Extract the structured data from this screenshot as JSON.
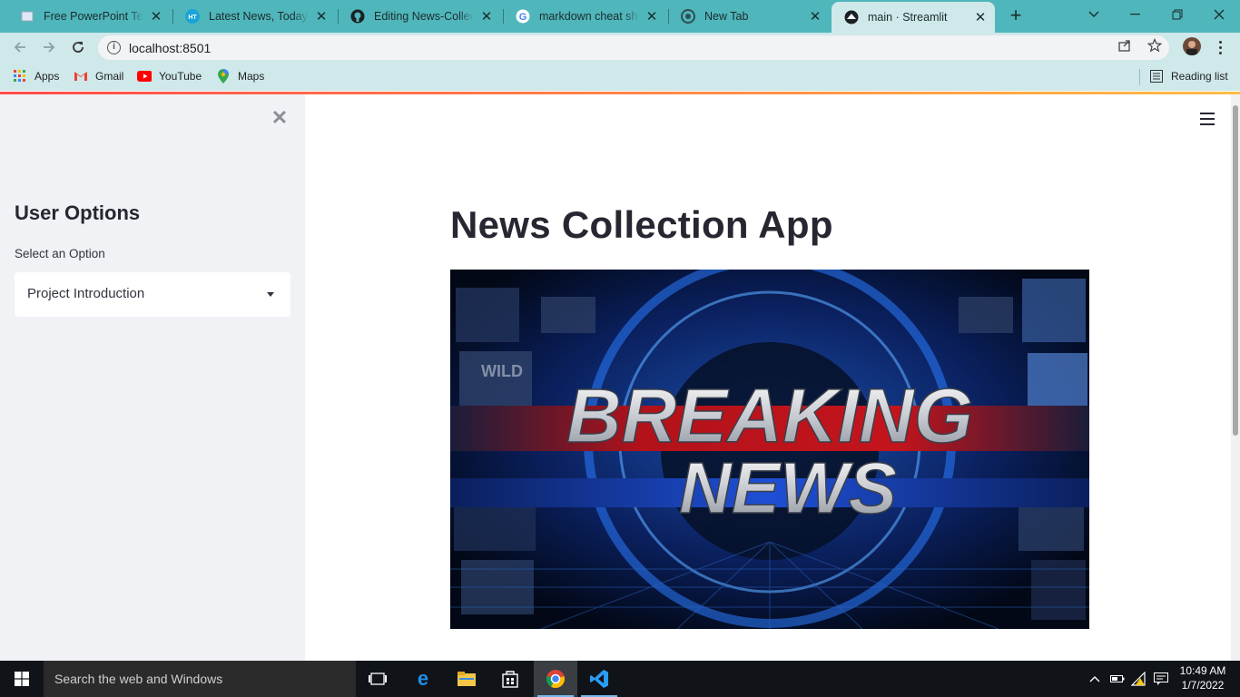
{
  "tabs": [
    {
      "title": "Free PowerPoint Temp",
      "icon": "slides-icon"
    },
    {
      "title": "Latest News, Today's E",
      "icon": "ht-icon"
    },
    {
      "title": "Editing News-Collectio",
      "icon": "github-icon"
    },
    {
      "title": "markdown cheat shee",
      "icon": "google-icon"
    },
    {
      "title": "New Tab",
      "icon": "chrome-icon"
    },
    {
      "title": "main · Streamlit",
      "icon": "streamlit-icon",
      "active": true
    }
  ],
  "address_bar": {
    "url": "localhost:8501"
  },
  "bookmarks": [
    {
      "label": "Apps",
      "icon": "apps-grid-icon"
    },
    {
      "label": "Gmail",
      "icon": "gmail-icon"
    },
    {
      "label": "YouTube",
      "icon": "youtube-icon"
    },
    {
      "label": "Maps",
      "icon": "maps-icon"
    }
  ],
  "reading_list": {
    "label": "Reading list"
  },
  "sidebar": {
    "title": "User Options",
    "select_label": "Select an Option",
    "select_value": "Project Introduction"
  },
  "main": {
    "title": "News Collection App",
    "hero_image": {
      "text_line1": "BREAKING",
      "text_line2": "NEWS",
      "overlay_text": "WILD"
    }
  },
  "taskbar": {
    "search_placeholder": "Search the web and Windows",
    "time": "10:49 AM",
    "date": "1/7/2022"
  },
  "colors": {
    "tabstrip": "#4fb6bb",
    "toolbar": "#cfe8ea",
    "sidebar": "#f0f2f6",
    "text": "#262730",
    "accent_start": "#ff4b4b",
    "accent_end": "#ffbd45"
  }
}
